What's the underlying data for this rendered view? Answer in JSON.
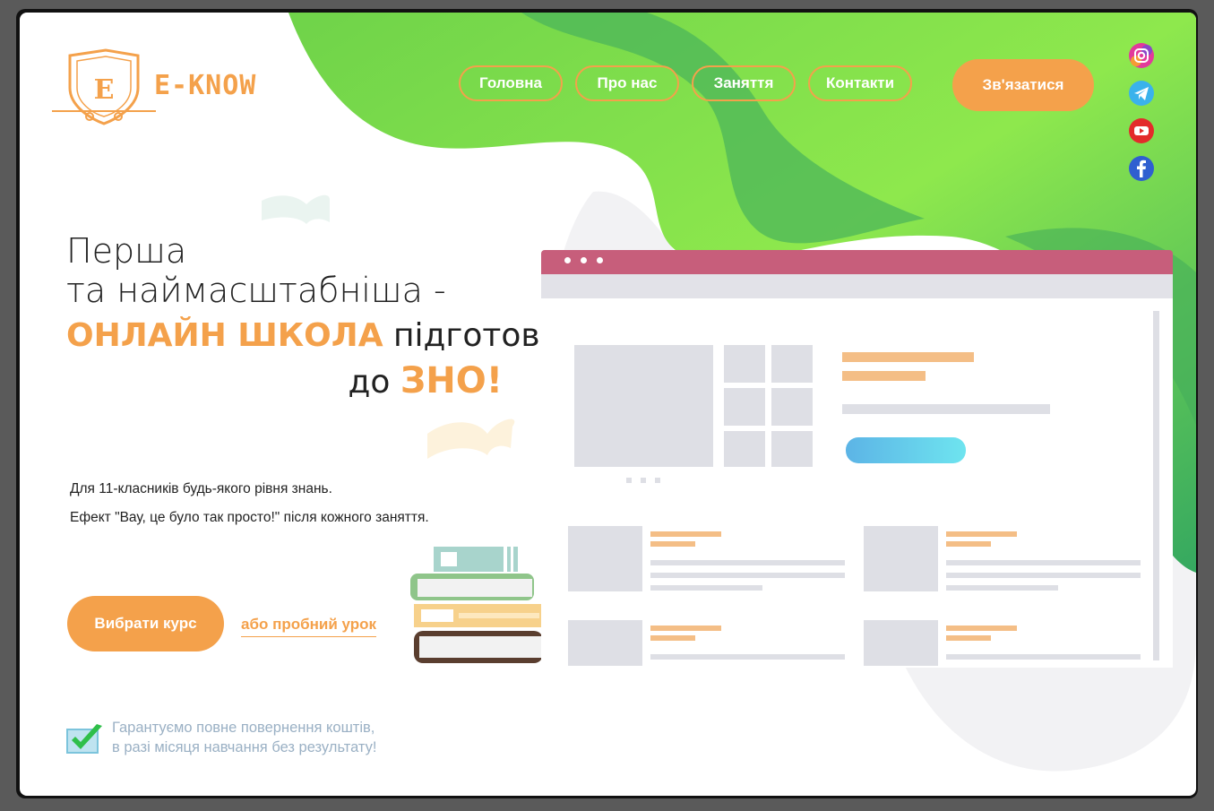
{
  "brand": {
    "name": "E-KNOW",
    "logo_letter": "E"
  },
  "nav": {
    "items": [
      "Головна",
      "Про нас",
      "Заняття",
      "Контакти"
    ],
    "contact_button": "Зв'язатися"
  },
  "socials": [
    "instagram-icon",
    "telegram-icon",
    "youtube-icon",
    "facebook-icon"
  ],
  "hero": {
    "line1": "Перша",
    "line2": "та наймасштабніша -",
    "line3_accent": "ОНЛАЙН ШКОЛА",
    "line3_rest": " підготовки",
    "line4_pre": "до ",
    "line4_accent": "ЗНО!",
    "desc1": "Для 11-класників будь-якого рівня знань.",
    "desc2": "Ефект \"Вау, це було так просто!\" після кожного заняття.",
    "cta_label": "Вибрати курс",
    "trial_label": "або пробний урок"
  },
  "guarantee": {
    "line1": "Гарантуємо повне повернення коштів,",
    "line2": "в разі місяця навчання без результату!"
  },
  "colors": {
    "accent": "#f4a14b",
    "green": "#7ee04e",
    "mock_bar": "#c75e7b"
  }
}
